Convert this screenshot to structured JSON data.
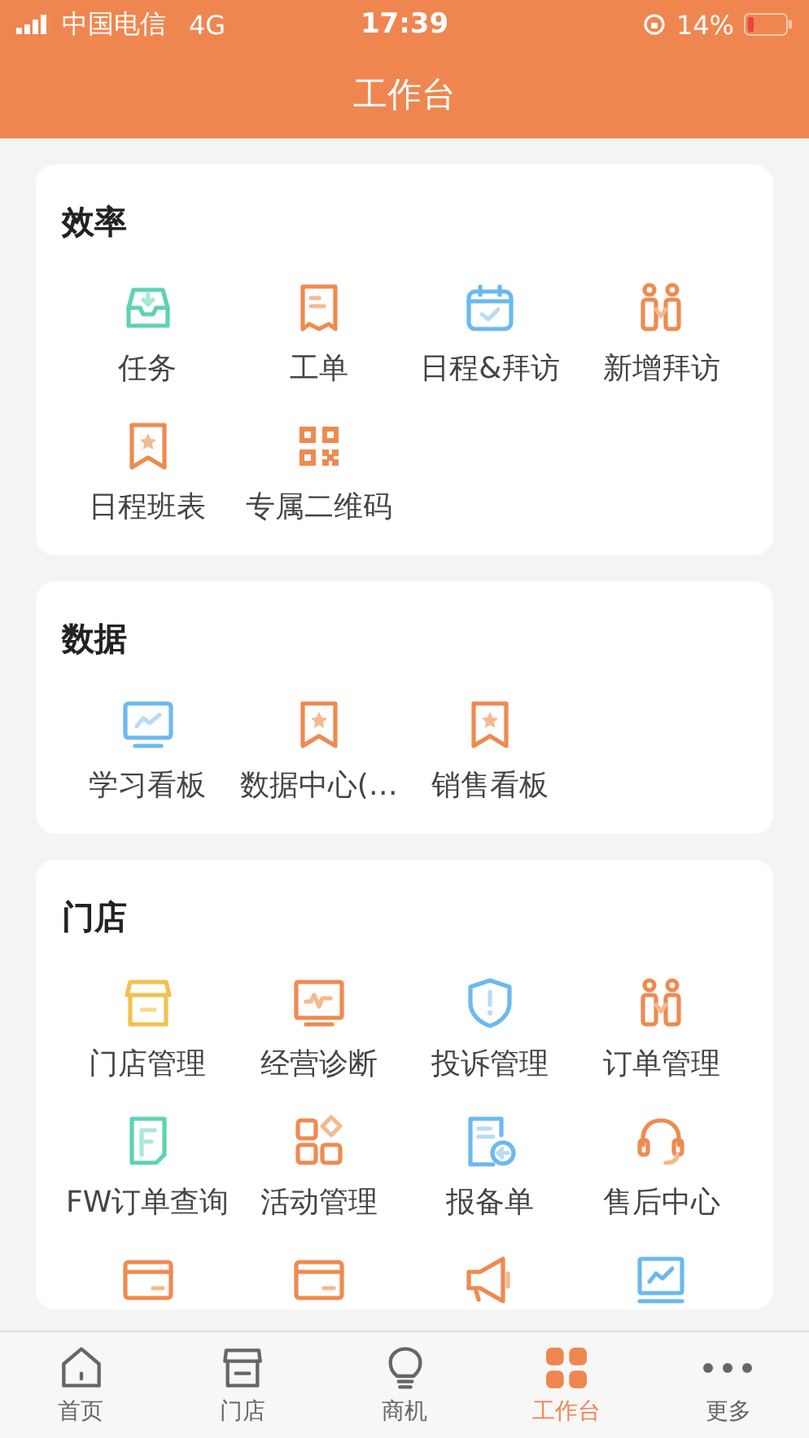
{
  "status_bar": {
    "carrier": "中国电信",
    "network": "4G",
    "time": "17:39",
    "battery": "14%"
  },
  "title": "工作台",
  "sections": [
    {
      "title": "效率",
      "items": [
        {
          "label": "任务",
          "kind": "inbox"
        },
        {
          "label": "工单",
          "kind": "receipt"
        },
        {
          "label": "日程&拜访",
          "kind": "calendar"
        },
        {
          "label": "新增拜访",
          "kind": "people"
        },
        {
          "label": "日程班表",
          "kind": "bookmark"
        },
        {
          "label": "专属二维码",
          "kind": "qr"
        }
      ]
    },
    {
      "title": "数据",
      "items": [
        {
          "label": "学习看板",
          "kind": "screen"
        },
        {
          "label": "数据中心(…",
          "kind": "bookmark"
        },
        {
          "label": "销售看板",
          "kind": "bookmark"
        }
      ]
    },
    {
      "title": "门店",
      "items": [
        {
          "label": "门店管理",
          "kind": "store"
        },
        {
          "label": "经营诊断",
          "kind": "pulse"
        },
        {
          "label": "投诉管理",
          "kind": "shield"
        },
        {
          "label": "订单管理",
          "kind": "people"
        },
        {
          "label": "FW订单查询",
          "kind": "doc"
        },
        {
          "label": "活动管理",
          "kind": "blocks"
        },
        {
          "label": "报备单",
          "kind": "form"
        },
        {
          "label": "售后中心",
          "kind": "headset"
        },
        {
          "kind": "card"
        },
        {
          "kind": "card"
        },
        {
          "kind": "megaphone"
        },
        {
          "kind": "board"
        }
      ]
    }
  ],
  "tabs": [
    {
      "label": "首页",
      "kind": "home",
      "selected": false
    },
    {
      "label": "门店",
      "kind": "store",
      "selected": false
    },
    {
      "label": "商机",
      "kind": "bulb",
      "selected": false
    },
    {
      "label": "工作台",
      "kind": "grid",
      "selected": true
    },
    {
      "label": "更多",
      "kind": "more",
      "selected": false
    }
  ]
}
